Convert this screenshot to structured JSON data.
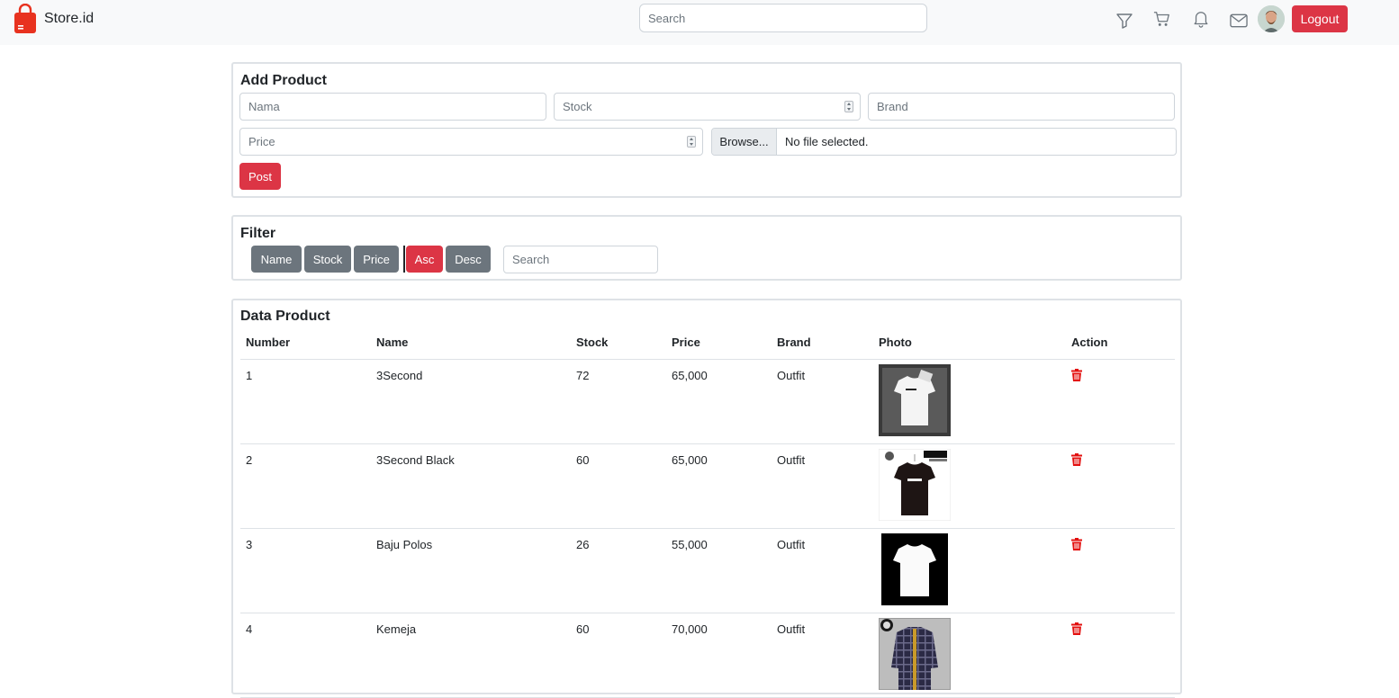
{
  "navbar": {
    "brand": "Store.id",
    "search_placeholder": "Search",
    "logout_label": "Logout"
  },
  "add_product": {
    "title": "Add Product",
    "name_placeholder": "Nama",
    "stock_placeholder": "Stock",
    "brand_placeholder": "Brand",
    "price_placeholder": "Price",
    "browse_label": "Browse...",
    "file_status": "No file selected.",
    "post_label": "Post"
  },
  "filter": {
    "title": "Filter",
    "name_label": "Name",
    "stock_label": "Stock",
    "price_label": "Price",
    "asc_label": "Asc",
    "desc_label": "Desc",
    "search_placeholder": "Search"
  },
  "data_product": {
    "title": "Data Product",
    "columns": [
      "Number",
      "Name",
      "Stock",
      "Price",
      "Brand",
      "Photo",
      "Action"
    ],
    "rows": [
      {
        "number": "1",
        "name": "3Second",
        "stock": "72",
        "price": "65,000",
        "brand": "Outfit"
      },
      {
        "number": "2",
        "name": "3Second Black",
        "stock": "60",
        "price": "65,000",
        "brand": "Outfit"
      },
      {
        "number": "3",
        "name": "Baju Polos",
        "stock": "26",
        "price": "55,000",
        "brand": "Outfit"
      },
      {
        "number": "4",
        "name": "Kemeja",
        "stock": "60",
        "price": "70,000",
        "brand": "Outfit"
      }
    ]
  },
  "colors": {
    "accent": "#dc3545",
    "secondary": "#6c757d",
    "navbar_bg": "#f8f9fa"
  }
}
